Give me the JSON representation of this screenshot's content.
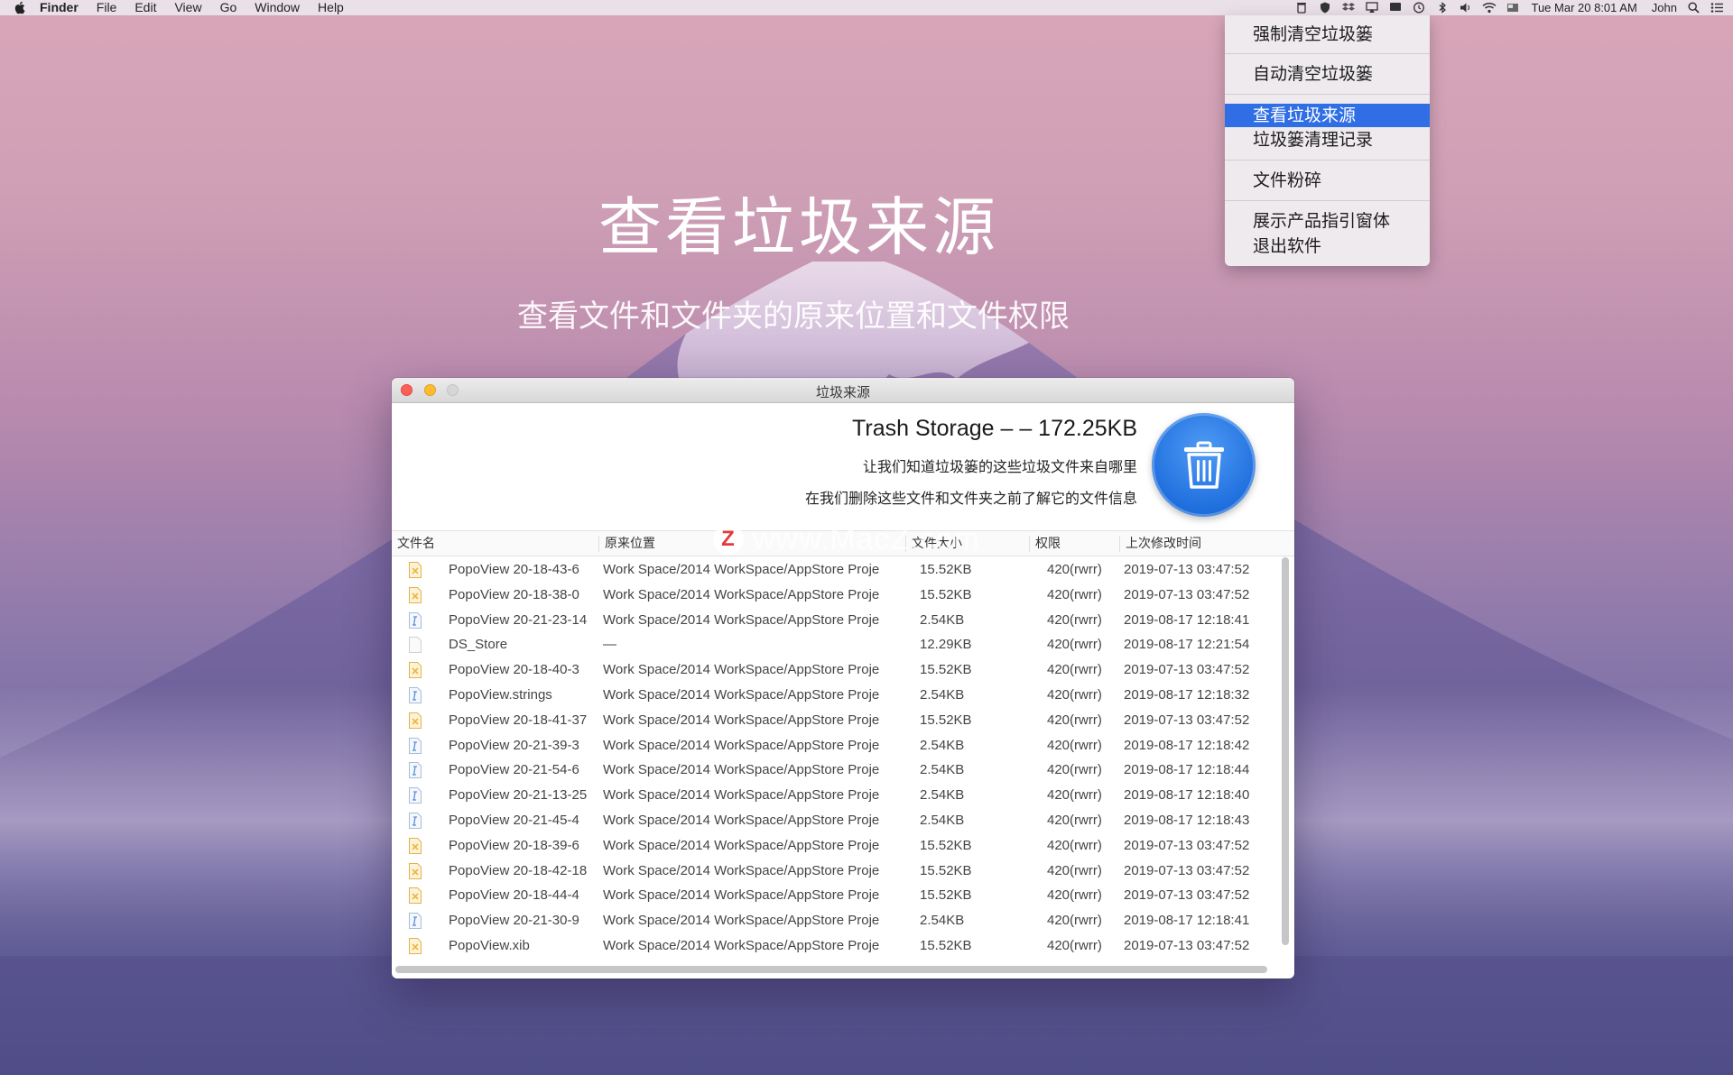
{
  "menubar": {
    "app_name": "Finder",
    "items": [
      "File",
      "Edit",
      "View",
      "Go",
      "Window",
      "Help"
    ],
    "clock": "Tue Mar 20  8:01 AM",
    "user": "John"
  },
  "dropdown": {
    "items": [
      {
        "label": "强制清空垃圾篓",
        "active": false
      },
      {
        "label": "自动清空垃圾篓",
        "active": false
      },
      {
        "label": "查看垃圾来源",
        "active": true
      },
      {
        "label": "垃圾篓清理记录",
        "active": false
      },
      {
        "label": "文件粉碎",
        "active": false
      },
      {
        "label": "展示产品指引窗体",
        "active": false
      },
      {
        "label": "退出软件",
        "active": false
      }
    ]
  },
  "hero": {
    "title": "查看垃圾来源",
    "subtitle": "查看文件和文件夹的原来位置和文件权限"
  },
  "window": {
    "title": "垃圾来源",
    "storage": "Trash Storage – – 172.25KB",
    "desc1": "让我们知道垃圾篓的这些垃圾文件来自哪里",
    "desc2": "在我们删除这些文件和文件夹之前了解它的文件信息",
    "columns": [
      "文件名",
      "原来位置",
      "文件大小",
      "权限",
      "上次修改时间"
    ],
    "rows": [
      {
        "icon": "xib",
        "name": "PopoView 20-18-43-6",
        "path": "Work Space/2014 WorkSpace/AppStore Proje",
        "size": "15.52KB",
        "perm": "420(rwrr)",
        "modified": "2019-07-13 03:47:52"
      },
      {
        "icon": "xib",
        "name": "PopoView 20-18-38-0",
        "path": "Work Space/2014 WorkSpace/AppStore Proje",
        "size": "15.52KB",
        "perm": "420(rwrr)",
        "modified": "2019-07-13 03:47:52"
      },
      {
        "icon": "strings",
        "name": "PopoView 20-21-23-14",
        "path": "Work Space/2014 WorkSpace/AppStore Proje",
        "size": "2.54KB",
        "perm": "420(rwrr)",
        "modified": "2019-08-17 12:18:41"
      },
      {
        "icon": "blank",
        "name": "DS_Store",
        "path": "—",
        "size": "12.29KB",
        "perm": "420(rwrr)",
        "modified": "2019-08-17 12:21:54"
      },
      {
        "icon": "xib",
        "name": "PopoView 20-18-40-3",
        "path": "Work Space/2014 WorkSpace/AppStore Proje",
        "size": "15.52KB",
        "perm": "420(rwrr)",
        "modified": "2019-07-13 03:47:52"
      },
      {
        "icon": "strings",
        "name": "PopoView.strings",
        "path": "Work Space/2014 WorkSpace/AppStore Proje",
        "size": "2.54KB",
        "perm": "420(rwrr)",
        "modified": "2019-08-17 12:18:32"
      },
      {
        "icon": "xib",
        "name": "PopoView 20-18-41-37",
        "path": "Work Space/2014 WorkSpace/AppStore Proje",
        "size": "15.52KB",
        "perm": "420(rwrr)",
        "modified": "2019-07-13 03:47:52"
      },
      {
        "icon": "strings",
        "name": "PopoView 20-21-39-3",
        "path": "Work Space/2014 WorkSpace/AppStore Proje",
        "size": "2.54KB",
        "perm": "420(rwrr)",
        "modified": "2019-08-17 12:18:42"
      },
      {
        "icon": "strings",
        "name": "PopoView 20-21-54-6",
        "path": "Work Space/2014 WorkSpace/AppStore Proje",
        "size": "2.54KB",
        "perm": "420(rwrr)",
        "modified": "2019-08-17 12:18:44"
      },
      {
        "icon": "strings",
        "name": "PopoView 20-21-13-25",
        "path": "Work Space/2014 WorkSpace/AppStore Proje",
        "size": "2.54KB",
        "perm": "420(rwrr)",
        "modified": "2019-08-17 12:18:40"
      },
      {
        "icon": "strings",
        "name": "PopoView 20-21-45-4",
        "path": "Work Space/2014 WorkSpace/AppStore Proje",
        "size": "2.54KB",
        "perm": "420(rwrr)",
        "modified": "2019-08-17 12:18:43"
      },
      {
        "icon": "xib",
        "name": "PopoView 20-18-39-6",
        "path": "Work Space/2014 WorkSpace/AppStore Proje",
        "size": "15.52KB",
        "perm": "420(rwrr)",
        "modified": "2019-07-13 03:47:52"
      },
      {
        "icon": "xib",
        "name": "PopoView 20-18-42-18",
        "path": "Work Space/2014 WorkSpace/AppStore Proje",
        "size": "15.52KB",
        "perm": "420(rwrr)",
        "modified": "2019-07-13 03:47:52"
      },
      {
        "icon": "xib",
        "name": "PopoView 20-18-44-4",
        "path": "Work Space/2014 WorkSpace/AppStore Proje",
        "size": "15.52KB",
        "perm": "420(rwrr)",
        "modified": "2019-07-13 03:47:52"
      },
      {
        "icon": "strings",
        "name": "PopoView 20-21-30-9",
        "path": "Work Space/2014 WorkSpace/AppStore Proje",
        "size": "2.54KB",
        "perm": "420(rwrr)",
        "modified": "2019-08-17 12:18:41"
      },
      {
        "icon": "xib",
        "name": "PopoView.xib",
        "path": "Work Space/2014 WorkSpace/AppStore Proje",
        "size": "15.52KB",
        "perm": "420(rwrr)",
        "modified": "2019-07-13 03:47:52"
      }
    ]
  },
  "watermark": {
    "text": "www.MacZ.com",
    "logo": "Z"
  },
  "colors": {
    "accent": "#2f6ee5",
    "trash_button": "#1f6fde",
    "xib_icon": "#f0b63c",
    "strings_icon": "#5a8fd8"
  }
}
